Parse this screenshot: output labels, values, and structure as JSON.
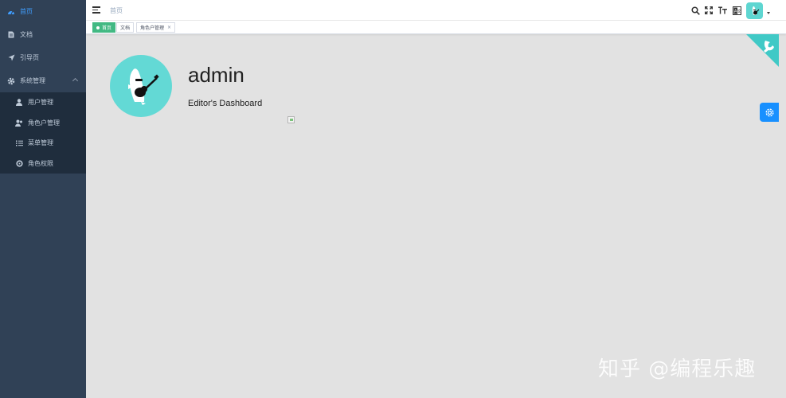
{
  "sidebar": {
    "items": [
      {
        "label": "首页",
        "icon": "dashboard-icon",
        "active": true
      },
      {
        "label": "文档",
        "icon": "document-icon"
      },
      {
        "label": "引导页",
        "icon": "guide-icon"
      },
      {
        "label": "系统管理",
        "icon": "gear-icon",
        "expanded": true
      }
    ],
    "sub_items": [
      {
        "label": "用户管理",
        "icon": "user-icon"
      },
      {
        "label": "角色户管理",
        "icon": "users-icon"
      },
      {
        "label": "菜单管理",
        "icon": "list-icon"
      },
      {
        "label": "角色权限",
        "icon": "permission-icon"
      }
    ]
  },
  "navbar": {
    "breadcrumb": "首页",
    "tools": [
      "search-icon",
      "fullscreen-icon",
      "font-size-icon",
      "translate-icon"
    ]
  },
  "tags": [
    {
      "label": "首页",
      "active": true
    },
    {
      "label": "文档"
    },
    {
      "label": "角色户管理",
      "closable": true,
      "close": "×"
    }
  ],
  "main": {
    "username": "admin",
    "role_text": "Editor's Dashboard"
  },
  "watermark": "知乎 @编程乐趣",
  "colors": {
    "sidebar_bg": "#304156",
    "submenu_bg": "#1f2d3d",
    "active_menu": "#409eff",
    "tag_active": "#42b983",
    "avatar_teal": "#63d9d5",
    "settings_blue": "#1890ff",
    "main_bg": "#e2e2e2"
  }
}
